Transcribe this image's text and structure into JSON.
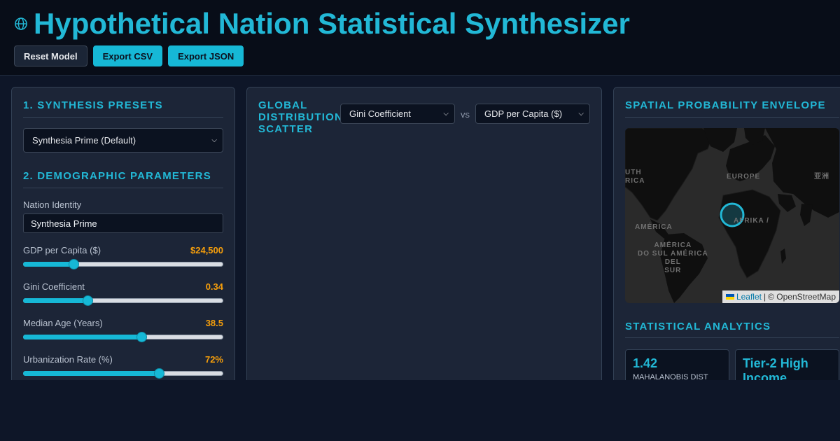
{
  "header": {
    "title": "Hypothetical Nation Statistical Synthesizer",
    "icon": "globe-icon",
    "buttons": {
      "reset": "Reset Model",
      "export_csv": "Export CSV",
      "export_json": "Export JSON"
    }
  },
  "colors": {
    "accent": "#22b8d6",
    "value": "#f59e0b",
    "background": "#0e1628",
    "panel": "#1c2537"
  },
  "left_panel": {
    "presets_heading": "1. Synthesis Presets",
    "preset_selected": "Synthesia Prime (Default)",
    "demographics_heading": "2. Demographic Parameters",
    "nation_label": "Nation Identity",
    "nation_value": "Synthesia Prime",
    "params": [
      {
        "label": "GDP per Capita ($)",
        "display": "$24,500",
        "level": 0.25
      },
      {
        "label": "Gini Coefficient",
        "display": "0.34",
        "level": 0.32
      },
      {
        "label": "Median Age (Years)",
        "display": "38.5",
        "level": 0.59
      },
      {
        "label": "Urbanization Rate (%)",
        "display": "72%",
        "level": 0.68
      }
    ]
  },
  "middle_panel": {
    "heading_line1": "Global",
    "heading_line2": "Distribution",
    "heading_line3": "Scatter",
    "x_axis_selected": "Gini Coefficient",
    "vs_label": "vs",
    "y_axis_selected": "GDP per Capita ($)"
  },
  "right_panel": {
    "map_heading": "Spatial Probability Envelope",
    "map_labels": {
      "north_america_partial": "UTH\nRICA",
      "europe": "EUROPE",
      "asia": "亚洲",
      "america": "AMÉRICA",
      "south_america": "AMÉRICA\nDO SUL AMÉRICA\nDEL\nSUR",
      "africa": "AFRIKA /"
    },
    "attribution_link": "Leaflet",
    "attribution_sep": "|",
    "attribution_text": "© OpenStreetMap",
    "analytics_heading": "Statistical Analytics",
    "stats": [
      {
        "value": "1.42",
        "caption": "MAHALANOBIS DIST"
      },
      {
        "value": "Tier-2 High Income",
        "caption": ""
      }
    ]
  }
}
